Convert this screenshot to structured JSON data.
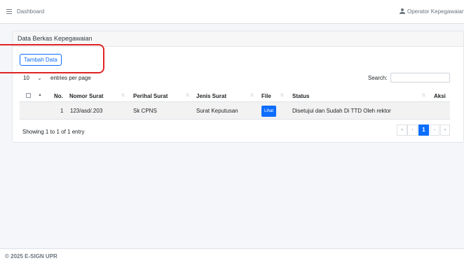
{
  "topbar": {
    "breadcrumb": "Dashboard",
    "user_name": "Operator Kepegawaian"
  },
  "card": {
    "title": "Data Berkas Kepegawaian",
    "add_button": "Tambah Data"
  },
  "table_controls": {
    "page_length": "10",
    "length_label": "entries per page",
    "search_label": "Search:",
    "search_value": ""
  },
  "table": {
    "columns": [
      "No.",
      "Nomor Surat",
      "Perihal Surat",
      "Jenis Surat",
      "File",
      "Status",
      "Aksi"
    ],
    "rows": [
      {
        "no": "1",
        "nomor_surat": "123/asd/.203",
        "perihal": "Sk CPNS",
        "jenis": "Surat Keputusan",
        "file_button": "Lihat",
        "status": "Disetujui dan Sudah Di TTD Oleh rektor"
      }
    ]
  },
  "pagination": {
    "info": "Showing 1 to 1 of 1 entry",
    "first": "«",
    "prev": "‹",
    "current": "1",
    "next": "›",
    "last": "»"
  },
  "footer": {
    "copyright": "© 2025 E-SIGN UPR"
  },
  "colors": {
    "primary": "#0d6efd",
    "annotation": "#e02424"
  },
  "icons": {
    "menu": "hamburger-icon",
    "user": "user-icon",
    "checkbox": "checkbox-icon",
    "sort": "sort-icon"
  }
}
